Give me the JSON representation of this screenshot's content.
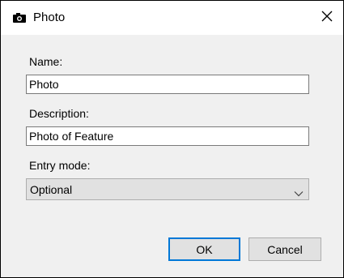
{
  "window": {
    "title": "Photo",
    "title_icon": "camera-icon",
    "close_icon": "close-icon"
  },
  "form": {
    "name_label": "Name:",
    "name_value": "Photo",
    "description_label": "Description:",
    "description_value": "Photo of Feature",
    "entry_mode_label": "Entry mode:",
    "entry_mode_value": "Optional",
    "entry_mode_icon": "chevron-down-icon"
  },
  "buttons": {
    "ok_label": "OK",
    "cancel_label": "Cancel"
  },
  "colors": {
    "accent": "#0078d7",
    "dialog_background": "#f0f0f0",
    "button_background": "#e1e1e1"
  }
}
